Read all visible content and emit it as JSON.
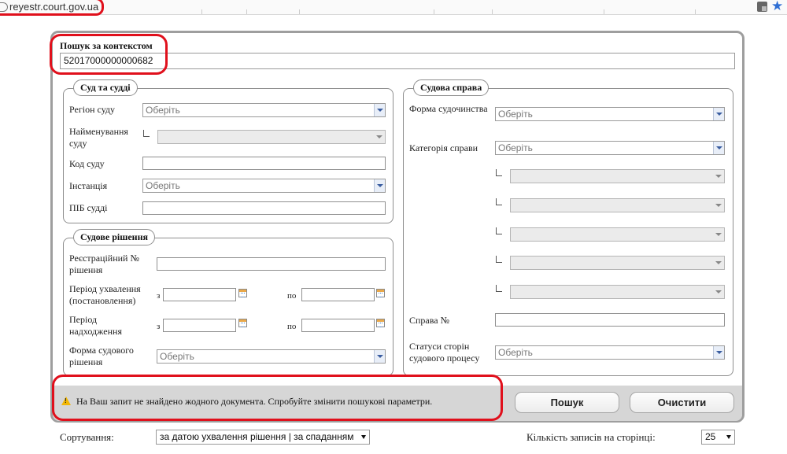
{
  "browser": {
    "url": "reyestr.court.gov.ua"
  },
  "context_search": {
    "label": "Пошук за контекстом",
    "value": "52017000000000682"
  },
  "court_section": {
    "legend": "Суд та судді",
    "region_label": "Регіон суду",
    "region_value": "Оберіть",
    "court_name_label": "Найменування суду",
    "court_code_label": "Код суду",
    "instance_label": "Інстанція",
    "instance_value": "Оберіть",
    "judge_label": "ПІБ судді"
  },
  "decision_section": {
    "legend": "Судове рішення",
    "reg_number_label": "Реєстраційний № рішення",
    "adoption_period_label": "Період ухвалення (постановлення)",
    "receipt_period_label": "Період надходження",
    "from_label": "з",
    "to_label": "по",
    "decision_form_label": "Форма судового рішення",
    "decision_form_value": "Оберіть"
  },
  "case_section": {
    "legend": "Судова справа",
    "proceeding_form_label": "Форма судочинства",
    "proceeding_form_value": "Оберіть",
    "case_category_label": "Категорія справи",
    "case_category_value": "Оберіть",
    "case_number_label": "Справа №",
    "party_status_label": "Статуси сторін судового процесу",
    "party_status_value": "Оберіть"
  },
  "result": {
    "message": "На Ваш запит не знайдено жодного документа. Спробуйте змінити пошукові параметри."
  },
  "buttons": {
    "search": "Пошук",
    "clear": "Очистити"
  },
  "sorting": {
    "label": "Сортування:",
    "value": "за датою ухвалення рішення | за спаданням"
  },
  "page_size": {
    "label": "Кількість записів на сторінці:",
    "value": "25"
  },
  "colors": {
    "annotation_red": "#e0101c",
    "panel_border": "#9e9e9e",
    "message_bar": "#d6d6d6"
  }
}
